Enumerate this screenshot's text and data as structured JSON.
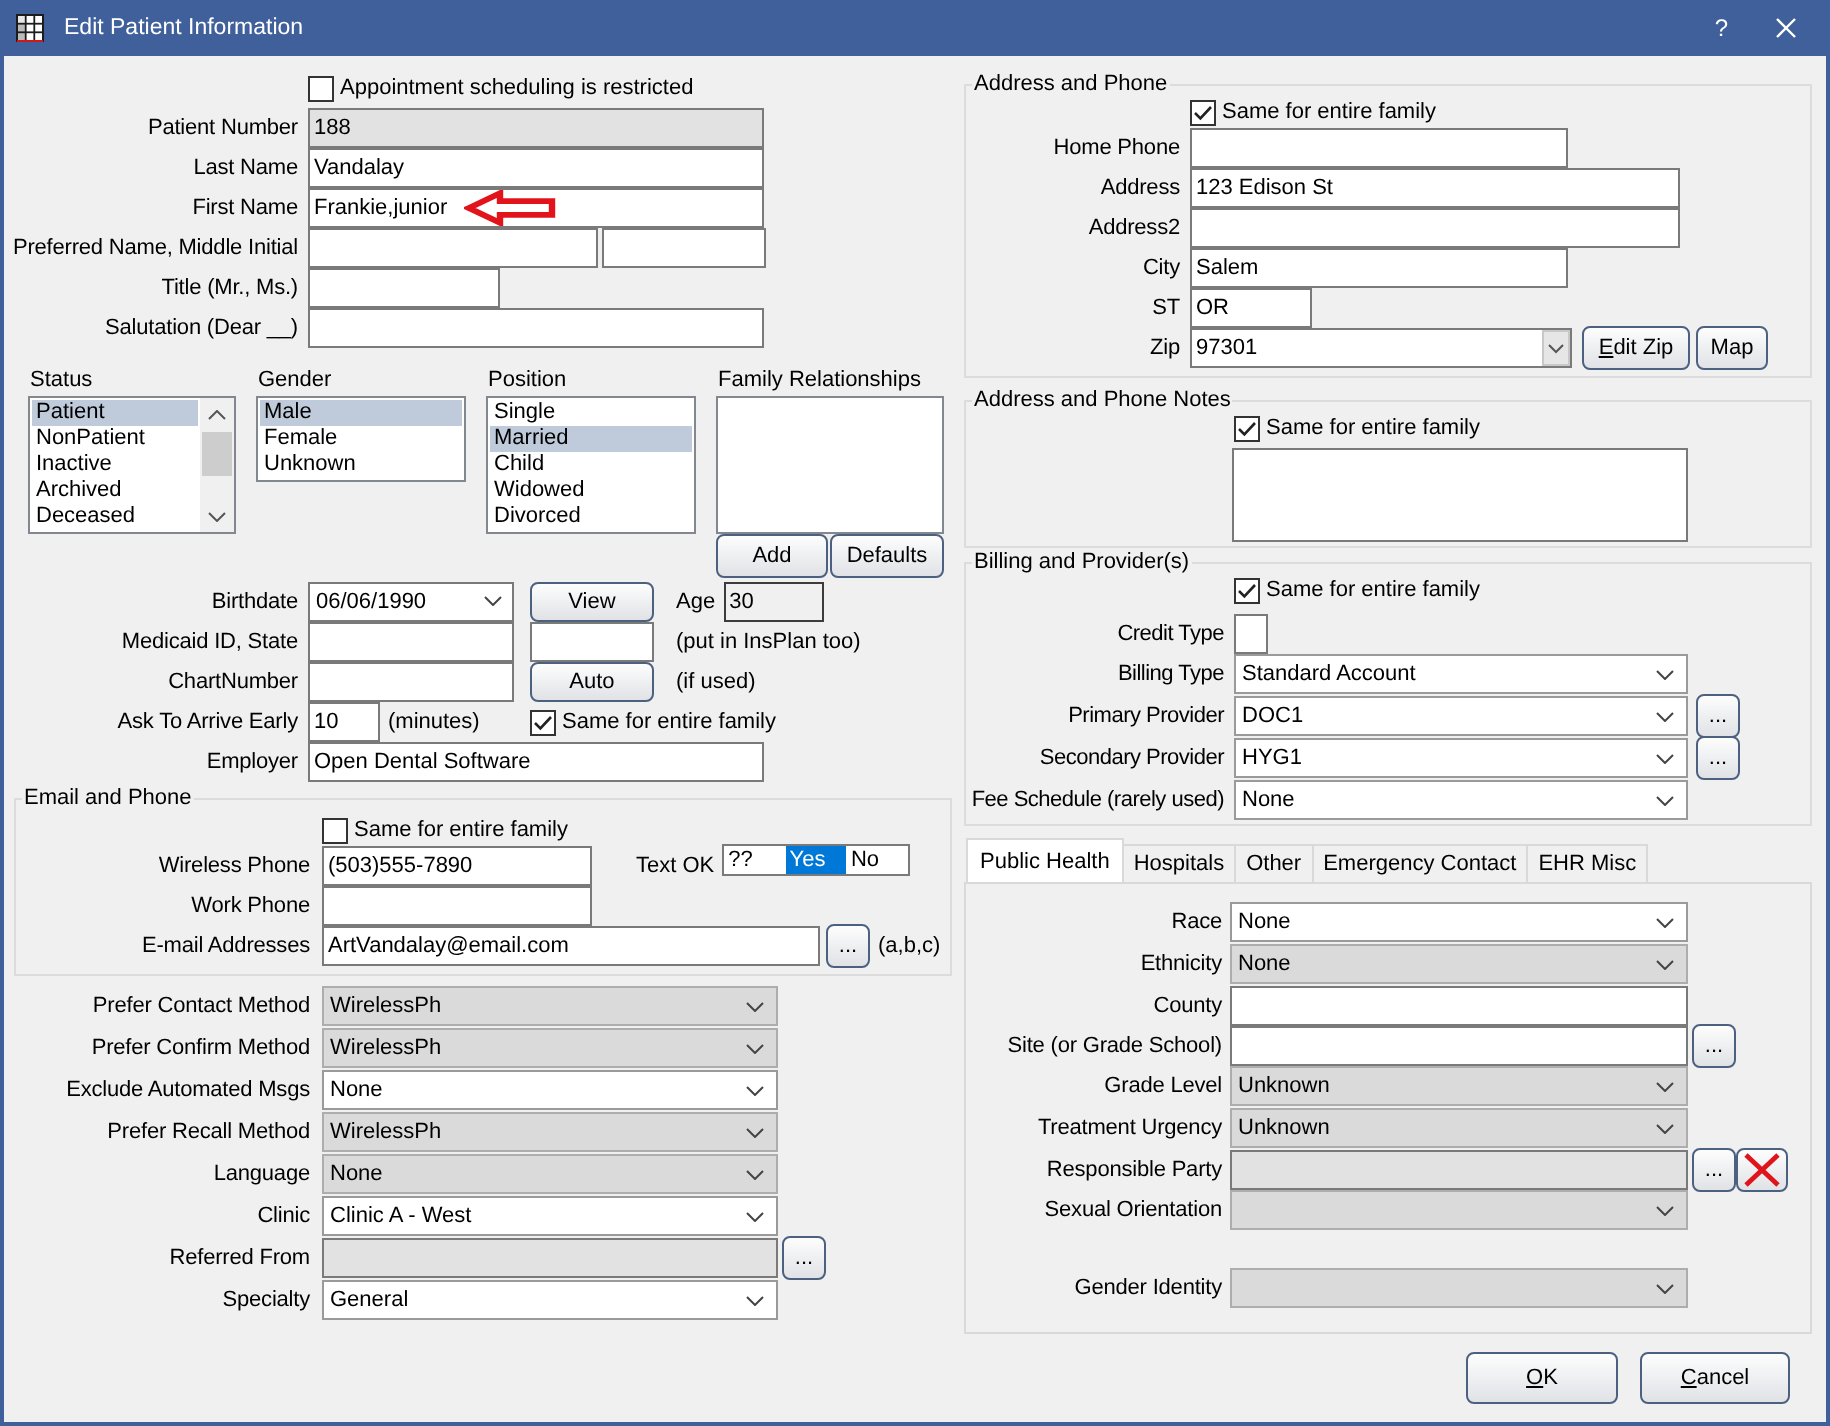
{
  "window": {
    "title": "Edit Patient Information",
    "help": "?"
  },
  "scheduling_restricted": {
    "label": "Appointment scheduling is restricted",
    "checked": false
  },
  "identity": [
    {
      "label": "Patient Number",
      "inputs": [
        {
          "value": "188",
          "readonly": true,
          "pointer": false
        }
      ]
    },
    {
      "label": "Last Name",
      "inputs": [
        {
          "value": "Vandalay",
          "readonly": false,
          "pointer": false
        }
      ]
    },
    {
      "label": "First Name",
      "inputs": [
        {
          "value": "Frankie,junior",
          "readonly": false,
          "pointer": true
        }
      ]
    },
    {
      "label": "Preferred Name, Middle Initial",
      "inputs": [
        {
          "readonly": false,
          "pointer": false
        },
        {
          "readonly": false,
          "pointer": false
        }
      ]
    },
    {
      "label": "Title (Mr., Ms.)",
      "inputs": [
        {
          "readonly": false,
          "pointer": false
        }
      ]
    },
    {
      "label": "Salutation (Dear __)",
      "inputs": [
        {
          "readonly": false,
          "pointer": false
        }
      ]
    }
  ],
  "lists": [
    {
      "title": "Status",
      "scrollbar": true,
      "items": [
        {
          "text": "Patient",
          "selected": true
        },
        {
          "text": "NonPatient",
          "selected": false
        },
        {
          "text": "Inactive",
          "selected": false
        },
        {
          "text": "Archived",
          "selected": false
        },
        {
          "text": "Deceased",
          "selected": false
        }
      ]
    },
    {
      "title": "Gender",
      "scrollbar": false,
      "items": [
        {
          "text": "Male",
          "selected": true
        },
        {
          "text": "Female",
          "selected": false
        },
        {
          "text": "Unknown",
          "selected": false
        }
      ]
    },
    {
      "title": "Position",
      "scrollbar": false,
      "items": [
        {
          "text": "Single",
          "selected": false
        },
        {
          "text": "Married",
          "selected": true
        },
        {
          "text": "Child",
          "selected": false
        },
        {
          "text": "Widowed",
          "selected": false
        },
        {
          "text": "Divorced",
          "selected": false
        }
      ]
    },
    {
      "title": "Family Relationships",
      "scrollbar": false,
      "buttons": [
        "Add",
        "Defaults"
      ]
    }
  ],
  "birthdate": {
    "label": "Birthdate",
    "value": "06/06/1990",
    "button": "View",
    "age_label": "Age",
    "age": "30"
  },
  "medicaid": {
    "label": "Medicaid ID, State",
    "note": "(put in InsPlan too)"
  },
  "chart_number": {
    "label": "ChartNumber",
    "button": "Auto",
    "note": "(if used)"
  },
  "arrive_early": {
    "label": "Ask To Arrive Early",
    "value": "10",
    "unit": "(minutes)",
    "family": {
      "label": "Same for entire family",
      "checked": true
    }
  },
  "employer": {
    "label": "Employer",
    "value": "Open Dental Software"
  },
  "email_phone": {
    "title": "Email and Phone",
    "family": {
      "label": "Same for entire family",
      "checked": false
    },
    "wireless": {
      "label": "Wireless Phone",
      "value": "(503)555-7890"
    },
    "text_ok": {
      "label": "Text OK",
      "options": [
        {
          "text": "??",
          "selected": false
        },
        {
          "text": "Yes",
          "selected": true
        },
        {
          "text": "No",
          "selected": false
        }
      ]
    },
    "work": {
      "label": "Work Phone"
    },
    "email": {
      "label": "E-mail Addresses",
      "value": "ArtVandalay@email.com",
      "button": "...",
      "note": "(a,b,c)"
    }
  },
  "preferences": [
    {
      "kind": "combo",
      "label": "Prefer Contact Method",
      "value": "WirelessPh",
      "shaded": true
    },
    {
      "kind": "combo",
      "label": "Prefer Confirm Method",
      "value": "WirelessPh",
      "shaded": true
    },
    {
      "kind": "combo",
      "label": "Exclude Automated Msgs",
      "value": "None",
      "shaded": false
    },
    {
      "kind": "combo",
      "label": "Prefer Recall Method",
      "value": "WirelessPh",
      "shaded": true
    },
    {
      "kind": "combo",
      "label": "Language",
      "value": "None",
      "shaded": true
    },
    {
      "kind": "combo",
      "label": "Clinic",
      "value": "Clinic A - West",
      "shaded": false
    },
    {
      "kind": "text",
      "label": "Referred From",
      "readonly": true,
      "buttons": [
        {
          "kind": "ellipsis",
          "text": "..."
        }
      ]
    },
    {
      "kind": "combo",
      "label": "Specialty",
      "value": "General",
      "shaded": false
    }
  ],
  "address": {
    "title": "Address and Phone",
    "family": {
      "label": "Same for entire family",
      "checked": true
    },
    "rows": [
      {
        "kind": "text",
        "label": "Home Phone",
        "readonly": false
      },
      {
        "kind": "text",
        "label": "Address",
        "value": "123 Edison St",
        "readonly": false
      },
      {
        "kind": "text",
        "label": "Address2",
        "readonly": false
      },
      {
        "kind": "text",
        "label": "City",
        "value": "Salem",
        "readonly": false
      },
      {
        "kind": "text",
        "label": "ST",
        "value": "OR",
        "readonly": false
      },
      {
        "kind": "editable-combo",
        "label": "Zip",
        "value": "97301",
        "buttons": [
          {
            "kind": "text",
            "text": "Edit Zip",
            "underline_first": true
          },
          {
            "kind": "text",
            "text": "Map",
            "underline_first": false
          }
        ]
      }
    ]
  },
  "notes": {
    "title": "Address and Phone Notes",
    "family": {
      "label": "Same for entire family",
      "checked": true
    }
  },
  "billing": {
    "title": "Billing and Provider(s)",
    "family": {
      "label": "Same for entire family",
      "checked": true
    },
    "rows": [
      {
        "kind": "text",
        "label": "Credit Type",
        "readonly": false
      },
      {
        "kind": "combo",
        "label": "Billing Type",
        "value": "Standard Account",
        "shaded": false
      },
      {
        "kind": "combo",
        "label": "Primary Provider",
        "value": "DOC1",
        "shaded": false,
        "buttons": [
          {
            "kind": "ellipsis",
            "text": "..."
          }
        ]
      },
      {
        "kind": "combo",
        "label": "Secondary Provider",
        "value": "HYG1",
        "shaded": false,
        "buttons": [
          {
            "kind": "ellipsis",
            "text": "..."
          }
        ]
      },
      {
        "kind": "combo",
        "label": "Fee Schedule (rarely used)",
        "value": "None",
        "shaded": false
      }
    ]
  },
  "tabs": [
    {
      "label": "Public Health",
      "selected": true
    },
    {
      "label": "Hospitals",
      "selected": false
    },
    {
      "label": "Other",
      "selected": false
    },
    {
      "label": "Emergency Contact",
      "selected": false
    },
    {
      "label": "EHR Misc",
      "selected": false
    }
  ],
  "public_health": [
    {
      "kind": "combo",
      "label": "Race",
      "value": "None",
      "shaded": false
    },
    {
      "kind": "combo",
      "label": "Ethnicity",
      "value": "None",
      "shaded": true
    },
    {
      "kind": "text",
      "label": "County",
      "readonly": false
    },
    {
      "kind": "text",
      "label": "Site (or Grade School)",
      "readonly": false,
      "buttons": [
        {
          "kind": "ellipsis",
          "text": "..."
        }
      ]
    },
    {
      "kind": "combo",
      "label": "Grade Level",
      "value": "Unknown",
      "shaded": true
    },
    {
      "kind": "combo",
      "label": "Treatment Urgency",
      "value": "Unknown",
      "shaded": true
    },
    {
      "kind": "text",
      "label": "Responsible Party",
      "readonly": true,
      "buttons": [
        {
          "kind": "ellipsis",
          "text": "..."
        },
        {
          "kind": "delete"
        }
      ]
    },
    {
      "kind": "combo",
      "label": "Sexual Orientation",
      "shaded": true
    },
    {
      "kind": "combo",
      "label": "Gender Identity",
      "shaded": true
    }
  ],
  "footer": [
    {
      "text": "OK",
      "underline_first": true
    },
    {
      "text": "Cancel",
      "underline_first": true
    }
  ]
}
